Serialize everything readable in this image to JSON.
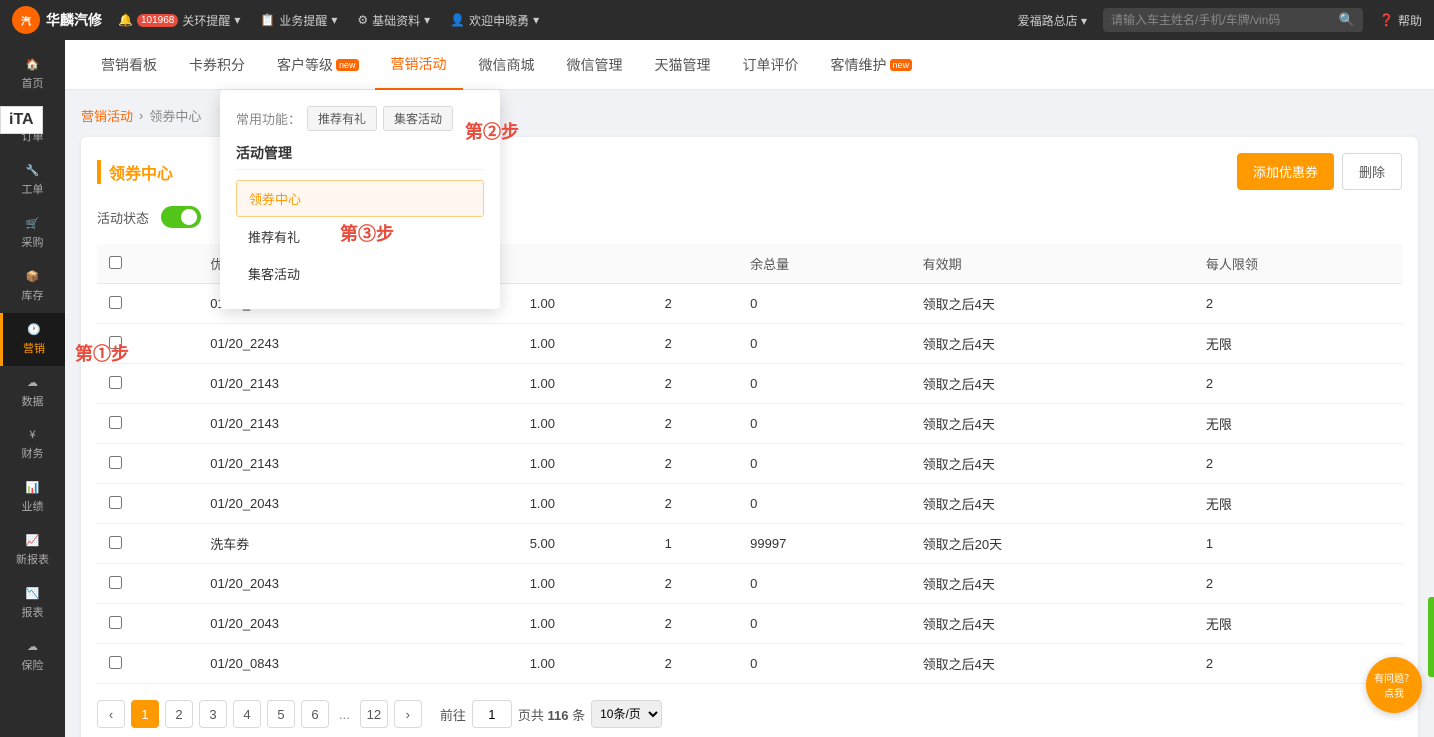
{
  "topBar": {
    "logoText": "华麟汽修",
    "notifications": {
      "label": "关环提醒",
      "badge": "101968"
    },
    "tasks": {
      "label": "业务提醒"
    },
    "settings": {
      "label": "基础资料"
    },
    "user": {
      "label": "欢迎申晓勇"
    },
    "store": "爱福路总店",
    "searchPlaceholder": "请输入车主姓名/手机/车牌/vin码",
    "helpLabel": "帮助"
  },
  "secondNav": {
    "tabs": [
      {
        "id": "marketing-board",
        "label": "营销看板"
      },
      {
        "id": "card-points",
        "label": "卡券积分"
      },
      {
        "id": "customer-level",
        "label": "客户等级",
        "hasNew": true
      },
      {
        "id": "marketing-activity",
        "label": "营销活动",
        "isActive": true
      },
      {
        "id": "wechat-mall",
        "label": "微信商城"
      },
      {
        "id": "wechat-mgmt",
        "label": "微信管理"
      },
      {
        "id": "tmall-mgmt",
        "label": "天猫管理"
      },
      {
        "id": "order-review",
        "label": "订单评价"
      },
      {
        "id": "customer-care",
        "label": "客情维护",
        "hasNew": true
      }
    ]
  },
  "sidebar": {
    "items": [
      {
        "id": "home",
        "icon": "home",
        "label": "首页"
      },
      {
        "id": "orders",
        "icon": "orders",
        "label": "订单"
      },
      {
        "id": "workorders",
        "icon": "workorders",
        "label": "工单"
      },
      {
        "id": "purchase",
        "icon": "purchase",
        "label": "采购"
      },
      {
        "id": "inventory",
        "icon": "inventory",
        "label": "库存"
      },
      {
        "id": "marketing",
        "icon": "marketing",
        "label": "营销",
        "isActive": true
      },
      {
        "id": "data",
        "icon": "data",
        "label": "数据"
      },
      {
        "id": "finance",
        "icon": "finance",
        "label": "财务"
      },
      {
        "id": "performance",
        "icon": "performance",
        "label": "业绩"
      },
      {
        "id": "reports-new",
        "icon": "reports-new",
        "label": "新报表"
      },
      {
        "id": "reports",
        "icon": "reports",
        "label": "报表"
      },
      {
        "id": "insurance",
        "icon": "insurance",
        "label": "保险"
      }
    ]
  },
  "breadcrumb": {
    "items": [
      "营销活动",
      "领券中心"
    ]
  },
  "page": {
    "sectionTitle": "领券中心",
    "statusLabel": "活动状态",
    "addButtonLabel": "添加优惠券",
    "deleteButtonLabel": "删除",
    "table": {
      "columns": [
        "",
        "优惠券",
        "",
        "",
        "",
        "余总量",
        "有效期",
        "每人限领"
      ],
      "rows": [
        {
          "check": false,
          "name": "01/20_2243",
          "col3": "",
          "col4": "1.00",
          "col5": "2",
          "remaining": "0",
          "validity": "领取之后4天",
          "limit": "2"
        },
        {
          "check": false,
          "name": "01/20_2243",
          "col3": "",
          "col4": "1.00",
          "col5": "2",
          "remaining": "0",
          "validity": "领取之后4天",
          "limit": "无限"
        },
        {
          "check": false,
          "name": "01/20_2143",
          "col3": "",
          "col4": "1.00",
          "col5": "2",
          "remaining": "0",
          "validity": "领取之后4天",
          "limit": "2"
        },
        {
          "check": false,
          "name": "01/20_2143",
          "col3": "",
          "col4": "1.00",
          "col5": "2",
          "remaining": "0",
          "validity": "领取之后4天",
          "limit": "无限"
        },
        {
          "check": false,
          "name": "01/20_2143",
          "col3": "",
          "col4": "1.00",
          "col5": "2",
          "remaining": "0",
          "validity": "领取之后4天",
          "limit": "2"
        },
        {
          "check": false,
          "name": "01/20_2043",
          "col3": "",
          "col4": "1.00",
          "col5": "2",
          "remaining": "0",
          "validity": "领取之后4天",
          "limit": "无限"
        },
        {
          "check": false,
          "name": "洗车券",
          "col3": "",
          "col4": "5.00",
          "col5": "1",
          "remaining": "99997",
          "validity": "领取之后20天",
          "limit": "1"
        },
        {
          "check": false,
          "name": "01/20_2043",
          "col3": "",
          "col4": "1.00",
          "col5": "2",
          "remaining": "0",
          "validity": "领取之后4天",
          "limit": "2"
        },
        {
          "check": false,
          "name": "01/20_2043",
          "col3": "",
          "col4": "1.00",
          "col5": "2",
          "remaining": "0",
          "validity": "领取之后4天",
          "limit": "无限"
        },
        {
          "check": false,
          "name": "01/20_0843",
          "col3": "",
          "col4": "1.00",
          "col5": "2",
          "remaining": "0",
          "validity": "领取之后4天",
          "limit": "2"
        }
      ]
    },
    "pagination": {
      "currentPage": 1,
      "totalPages": 12,
      "totalItems": "116",
      "pageSize": "10条/页",
      "pages": [
        1,
        2,
        3,
        4,
        5,
        6,
        12
      ],
      "gotoLabel": "前往",
      "totalLabel": "页共 116 条"
    }
  },
  "dropdown": {
    "commonLabel": "常用功能：",
    "commonTags": [
      "推荐有礼",
      "集客活动"
    ],
    "sectionTitle": "活动管理",
    "items": [
      {
        "id": "coupon-center",
        "label": "领券中心",
        "isSelected": true
      },
      {
        "id": "recommend-gift",
        "label": "推荐有礼"
      },
      {
        "id": "gather-activity",
        "label": "集客活动"
      }
    ]
  },
  "annotations": {
    "step1": "第①步",
    "step2": "第②步",
    "step3": "第③步"
  },
  "helpBubble": {
    "line1": "有问题？",
    "line2": "点我"
  },
  "iTA": "iTA"
}
